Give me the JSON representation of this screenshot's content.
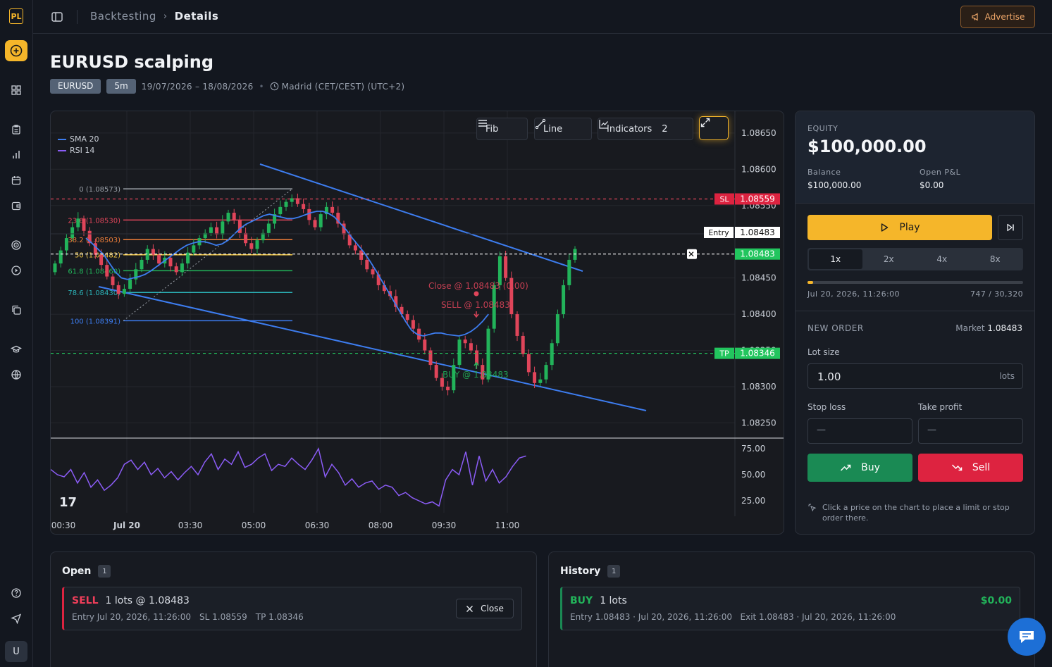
{
  "breadcrumb": {
    "parent": "Backtesting",
    "current": "Details"
  },
  "advertise_label": "Advertise",
  "header": {
    "title": "EURUSD scalping",
    "symbol": "EURUSD",
    "timeframe": "5m",
    "date_range": "19/07/2026 – 18/08/2026",
    "timezone": "Madrid (CET/CEST) (UTC+2)"
  },
  "rail": {
    "logo": "PL",
    "avatar": "U"
  },
  "toolbar": {
    "fib": "Fib",
    "line": "Line",
    "indicators": "Indicators",
    "indicators_count": "2"
  },
  "legend": [
    {
      "name": "SMA 20",
      "color": "#3d7df0"
    },
    {
      "name": "RSI 14",
      "color": "#8b5cf6"
    }
  ],
  "chart_data": {
    "type": "candlestick",
    "symbol": "EURUSD",
    "y_ticks": [
      "1.08650",
      "1.08600",
      "1.08550",
      "1.08450",
      "1.08400",
      "1.08350",
      "1.08300",
      "1.08250"
    ],
    "x_ticks": [
      "00:30",
      "Jul 20",
      "03:30",
      "05:00",
      "06:30",
      "08:00",
      "09:30",
      "11:00"
    ],
    "rsi_ticks": [
      "75.00",
      "50.00",
      "25.00"
    ],
    "ylim": [
      1.0823,
      1.0868
    ],
    "price_lines": {
      "sl": {
        "label": "SL",
        "value": "1.08559",
        "color": "#e0455a"
      },
      "entry": {
        "label": "Entry",
        "value": "1.08483"
      },
      "current": {
        "value": "1.08483",
        "color": "#22c55e"
      },
      "tp": {
        "label": "TP",
        "value": "1.08346",
        "color": "#22c55e"
      }
    },
    "fib_levels": [
      {
        "label": "0 (1.08573)",
        "color": "#9aa0a8"
      },
      {
        "label": "23.6 (1.08530)",
        "color": "#e0455a"
      },
      {
        "label": "38.2 (1.08503)",
        "color": "#f07f3a"
      },
      {
        "label": "50 (1.08482)",
        "color": "#f5c842"
      },
      {
        "label": "61.8 (1.08460)",
        "color": "#22b35a"
      },
      {
        "label": "78.6 (1.08430)",
        "color": "#2bb3b8"
      },
      {
        "label": "100 (1.08391)",
        "color": "#3d7df0"
      }
    ],
    "markers": [
      {
        "label": "Close @ 1.08483 (0.00)",
        "color": "#e0455a"
      },
      {
        "label": "SELL @ 1.08483",
        "color": "#e0455a"
      },
      {
        "label": "BUY @ 1.08483",
        "color": "#22b35a"
      }
    ],
    "closes": [
      1.0847,
      1.08488,
      1.08505,
      1.0852,
      1.08532,
      1.08515,
      1.08498,
      1.08482,
      1.08468,
      1.08452,
      1.0844,
      1.08428,
      1.08435,
      1.08448,
      1.08462,
      1.08475,
      1.0849,
      1.08482,
      1.0847,
      1.08478,
      1.08466,
      1.08458,
      1.0847,
      1.08485,
      1.08495,
      1.08505,
      1.08512,
      1.0852,
      1.0851,
      1.08528,
      1.0854,
      1.0853,
      1.08512,
      1.08498,
      1.0849,
      1.08502,
      1.08512,
      1.08525,
      1.08538,
      1.08548,
      1.08555,
      1.0856,
      1.08552,
      1.08545,
      1.0853,
      1.0852,
      1.08538,
      1.08548,
      1.0854,
      1.08525,
      1.0851,
      1.08495,
      1.08488,
      1.08475,
      1.08462,
      1.08455,
      1.0844,
      1.08432,
      1.08425,
      1.0841,
      1.084,
      1.08392,
      1.0838,
      1.08365,
      1.0835,
      1.0833,
      1.08312,
      1.083,
      1.08295,
      1.0833,
      1.08365,
      1.0836,
      1.0835,
      1.0833,
      1.0831,
      1.0838,
      1.0844,
      1.0848,
      1.0845,
      1.084,
      1.0837,
      1.08345,
      1.0832,
      1.08305,
      1.0831,
      1.0833,
      1.0836,
      1.084,
      1.0844,
      1.08475,
      1.0849
    ],
    "sma20": [
      1.08505,
      1.08498,
      1.0849,
      1.08482,
      1.0847,
      1.08458,
      1.0845,
      1.08448,
      1.0845,
      1.08452,
      1.08455,
      1.0846,
      1.08466,
      1.08472,
      1.08478,
      1.08484,
      1.0849,
      1.08495,
      1.08498,
      1.085,
      1.085,
      1.08498,
      1.08495,
      1.08497,
      1.08502,
      1.0851,
      1.08518,
      1.08524,
      1.08528,
      1.08532,
      1.08536,
      1.08538,
      1.08536,
      1.08534,
      1.08532,
      1.08532,
      1.08534,
      1.08537,
      1.0854,
      1.08542,
      1.08542,
      1.08539,
      1.08534,
      1.08525,
      1.08516,
      1.08505,
      1.08495,
      1.08485,
      1.08473,
      1.0846,
      1.08446,
      1.08432,
      1.08418,
      1.08404,
      1.0839,
      1.08378,
      1.08372,
      1.0837,
      1.08372,
      1.08374,
      1.08374,
      1.08372,
      1.08371,
      1.0837,
      1.08372,
      1.08376,
      1.08382,
      1.0839,
      1.084
    ],
    "rsi": [
      55,
      50,
      48,
      55,
      42,
      52,
      38,
      45,
      35,
      40,
      47,
      60,
      64,
      55,
      62,
      50,
      56,
      47,
      53,
      45,
      52,
      58,
      50,
      62,
      70,
      55,
      65,
      60,
      72,
      57,
      60,
      66,
      70,
      54,
      60,
      58,
      66,
      60,
      55,
      64,
      75,
      48,
      60,
      52,
      40,
      46,
      38,
      42,
      44,
      36,
      40,
      38,
      30,
      33,
      28,
      25,
      22,
      24,
      20,
      45,
      55,
      50,
      72,
      40,
      68,
      44,
      55,
      42,
      48,
      58,
      66,
      68
    ]
  },
  "equity": {
    "label": "EQUITY",
    "value": "$100,000.00",
    "balance_label": "Balance",
    "balance": "$100,000.00",
    "pnl_label": "Open P&L",
    "pnl": "$0.00"
  },
  "playback": {
    "play_label": "Play",
    "speeds": [
      "1x",
      "2x",
      "4x",
      "8x"
    ],
    "active_speed": "1x",
    "progress_fraction": 0.0246,
    "time": "Jul 20, 2026, 11:26:00",
    "position": "747 / 30,320"
  },
  "order": {
    "title": "NEW ORDER",
    "market_label": "Market",
    "market_price": "1.08483",
    "lot_label": "Lot size",
    "lot_value": "1.00",
    "lot_unit": "lots",
    "sl_label": "Stop loss",
    "tp_label": "Take profit",
    "sl_placeholder": "—",
    "tp_placeholder": "—",
    "buy_label": "Buy",
    "sell_label": "Sell",
    "hint": "Click a price on the chart to place a limit or stop order there."
  },
  "open_panel": {
    "title": "Open",
    "count": "1",
    "position": {
      "side": "SELL",
      "lots": "1 lots @ 1.08483",
      "entry": "Entry Jul 20, 2026, 11:26:00",
      "sl": "SL 1.08559",
      "tp": "TP 1.08346",
      "close_label": "Close"
    }
  },
  "history_panel": {
    "title": "History",
    "count": "1",
    "trade": {
      "side": "BUY",
      "lots": "1 lots",
      "pnl": "$0.00",
      "details": "Entry 1.08483 · Jul 20, 2026, 11:26:00   Exit 1.08483 · Jul 20, 2026, 11:26:00"
    }
  }
}
